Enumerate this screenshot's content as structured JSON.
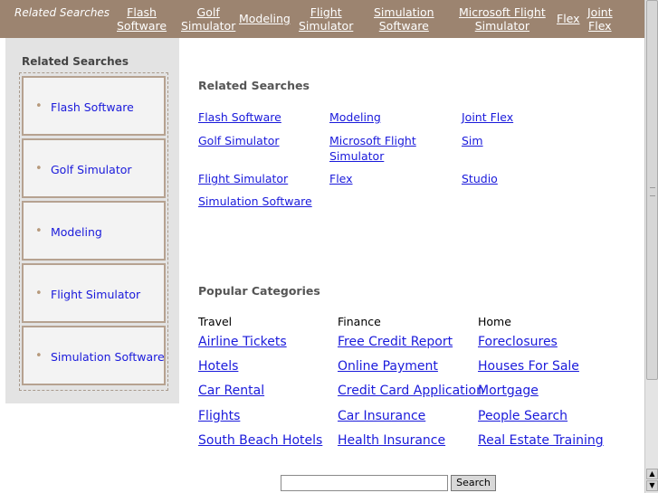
{
  "topbar": {
    "label": "Related Searches",
    "links": [
      {
        "line1": "Flash",
        "line2": "Software"
      },
      {
        "line1": "Golf",
        "line2": "Simulator"
      },
      {
        "line1": "Modeling",
        "line2": ""
      },
      {
        "line1": "Flight",
        "line2": "Simulator"
      },
      {
        "line1": "Simulation",
        "line2": "Software"
      },
      {
        "line1": "Microsoft Flight",
        "line2": "Simulator"
      },
      {
        "line1": "Flex",
        "line2": ""
      },
      {
        "line1": "Joint",
        "line2": "Flex"
      }
    ]
  },
  "sidebar": {
    "title": "Related Searches",
    "items": [
      "Flash Software",
      "Golf Simulator",
      "Modeling",
      "Flight Simulator",
      "Simulation Software"
    ]
  },
  "related": {
    "title": "Related Searches",
    "col1": [
      "Flash Software",
      "Golf Simulator",
      "Flight Simulator",
      "Simulation Software"
    ],
    "col2": [
      "Modeling",
      "Microsoft Flight Simulator",
      "Flex"
    ],
    "col3": [
      "Joint Flex",
      "Sim",
      "Studio"
    ]
  },
  "categories": {
    "title": "Popular Categories",
    "travel": {
      "heading": "Travel",
      "links": [
        "Airline Tickets",
        "Hotels",
        "Car Rental",
        "Flights",
        "South Beach Hotels"
      ]
    },
    "finance": {
      "heading": "Finance",
      "links": [
        "Free Credit Report",
        "Online Payment",
        "Credit Card Application",
        "Car Insurance",
        "Health Insurance"
      ]
    },
    "home": {
      "heading": "Home",
      "links": [
        "Foreclosures",
        "Houses For Sale",
        "Mortgage",
        "People Search",
        "Real Estate Training"
      ]
    }
  },
  "search": {
    "button_label": "Search",
    "value": ""
  },
  "colors": {
    "topbar": "#9c8470",
    "link": "#1a1adb",
    "sidebar_bg": "#e3e3e3",
    "item_border": "#b6a290"
  },
  "icons": {
    "bullet": "bullet-icon",
    "scroll_up": "arrow-up-icon",
    "scroll_down": "arrow-down-icon"
  }
}
